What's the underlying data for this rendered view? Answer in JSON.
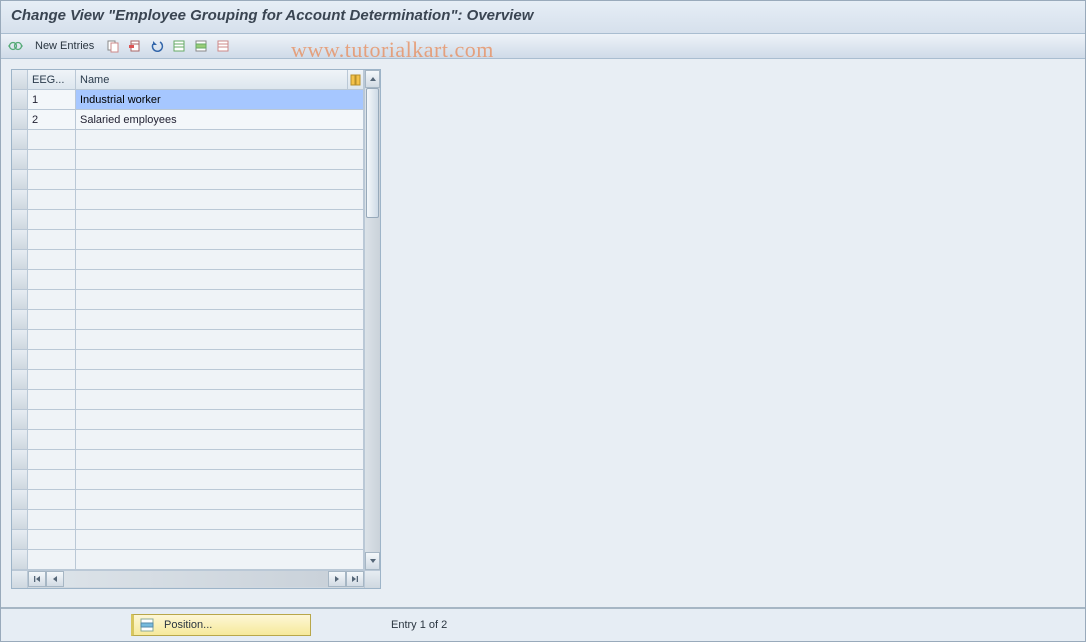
{
  "title": "Change View \"Employee Grouping for Account Determination\": Overview",
  "toolbar": {
    "new_entries_label": "New Entries"
  },
  "table": {
    "headers": {
      "col1": "EEG...",
      "col2": "Name"
    },
    "rows": [
      {
        "eeg": "1",
        "name": "Industrial worker",
        "selected": true
      },
      {
        "eeg": "2",
        "name": "Salaried employees",
        "selected": false
      }
    ],
    "empty_row_count": 22
  },
  "footer": {
    "position_label": "Position...",
    "entry_status": "Entry 1 of 2"
  },
  "watermark": "www.tutorialkart.com"
}
